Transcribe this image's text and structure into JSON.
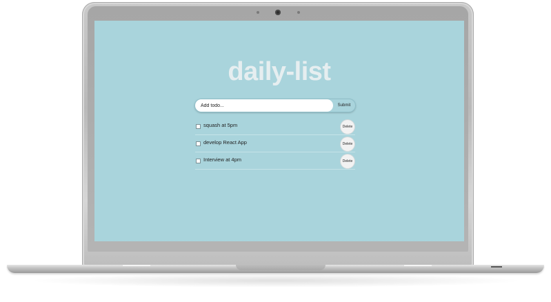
{
  "app": {
    "title": "daily-list"
  },
  "form": {
    "input_placeholder": "Add todo...",
    "submit_label": "Submit"
  },
  "todos": [
    {
      "text": "squash at 5pm",
      "delete_label": "Delete",
      "checked": false
    },
    {
      "text": "develop React App",
      "delete_label": "Delete",
      "checked": false
    },
    {
      "text": "Interview at 4pm",
      "delete_label": "Delete",
      "checked": false
    }
  ],
  "colors": {
    "screen_background": "#a9d4dc",
    "title_color": "#e6eef0",
    "laptop_silver": "#c4c4c4"
  }
}
